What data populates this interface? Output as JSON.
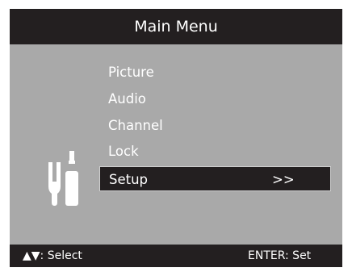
{
  "title": "Main Menu",
  "menu": {
    "items": [
      {
        "label": "Picture"
      },
      {
        "label": "Audio"
      },
      {
        "label": "Channel"
      },
      {
        "label": "Lock"
      },
      {
        "label": "Setup",
        "suffix": ">>",
        "selected": true
      }
    ]
  },
  "footer": {
    "select_hint": "▲▼: Select",
    "enter_hint": "ENTER: Set"
  },
  "colors": {
    "panel_background": "#a9a9a9",
    "bar_background": "#231f20",
    "text": "#ffffff"
  },
  "icons": {
    "setup_icon": "wrench-screwdriver-icon"
  }
}
